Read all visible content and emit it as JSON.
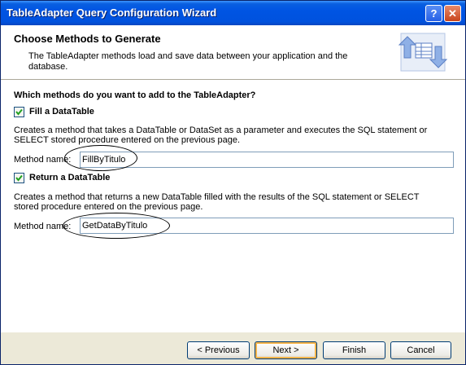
{
  "window": {
    "title": "TableAdapter Query Configuration Wizard",
    "help_label": "?",
    "close_label": "✕"
  },
  "header": {
    "title": "Choose Methods to Generate",
    "description": "The TableAdapter methods load and save data between your application and the database.",
    "icon": "table-adapter-icon"
  },
  "content": {
    "question": "Which methods do you want to add to the TableAdapter?",
    "fill": {
      "checked": true,
      "label": "Fill a DataTable",
      "description": "Creates a method that takes a DataTable or DataSet as a parameter and executes the SQL statement or SELECT stored procedure entered on the previous page.",
      "method_label": "Method name:",
      "method_value": "FillByTitulo"
    },
    "return": {
      "checked": true,
      "label": "Return a DataTable",
      "description": "Creates a method that returns a new DataTable filled with the results of the SQL statement or SELECT stored procedure entered on the previous page.",
      "method_label": "Method name:",
      "method_value": "GetDataByTitulo"
    }
  },
  "buttons": {
    "previous": "< Previous",
    "next": "Next >",
    "finish": "Finish",
    "cancel": "Cancel"
  }
}
